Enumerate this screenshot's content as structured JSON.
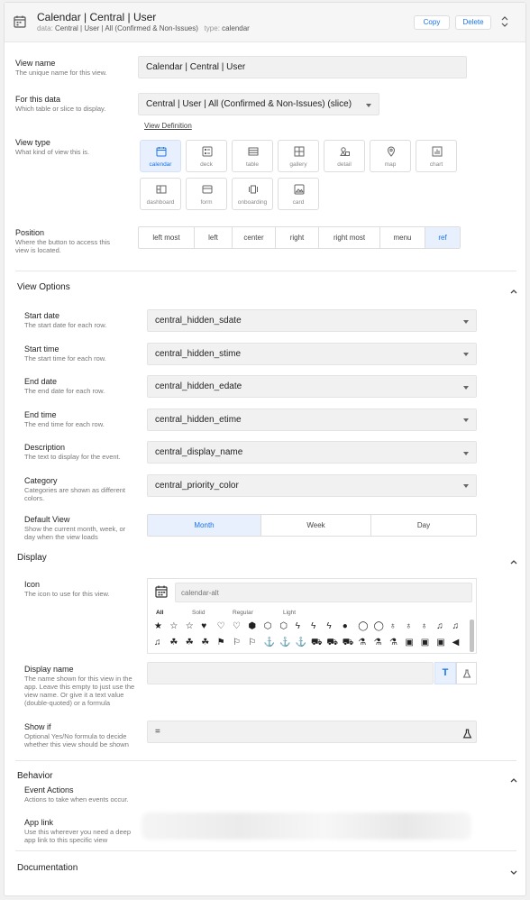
{
  "header": {
    "title": "Calendar | Central | User",
    "data_label": "data:",
    "data_value": "Central | User | All (Confirmed & Non-Issues)",
    "type_label": "type:",
    "type_value": "calendar",
    "copy_label": "Copy",
    "delete_label": "Delete"
  },
  "view_name": {
    "label": "View name",
    "desc": "The unique name for this view.",
    "value": "Calendar | Central | User"
  },
  "for_data": {
    "label": "For this data",
    "desc": "Which table or slice to display.",
    "value": "Central | User | All (Confirmed & Non-Issues) (slice)",
    "link": "View Definition"
  },
  "view_type": {
    "label": "View type",
    "desc": "What kind of view this is.",
    "options": [
      "calendar",
      "deck",
      "table",
      "gallery",
      "detail",
      "map",
      "chart",
      "dashboard",
      "form",
      "onboarding",
      "card"
    ],
    "selected": "calendar"
  },
  "position": {
    "label": "Position",
    "desc": "Where the button to access this view is located.",
    "options": [
      "left most",
      "left",
      "center",
      "right",
      "right most",
      "menu",
      "ref"
    ],
    "selected": "ref"
  },
  "view_options": {
    "title": "View Options",
    "fields": [
      {
        "label": "Start date",
        "desc": "The start date for each row.",
        "value": "central_hidden_sdate"
      },
      {
        "label": "Start time",
        "desc": "The start time for each row.",
        "value": "central_hidden_stime"
      },
      {
        "label": "End date",
        "desc": "The end date for each row.",
        "value": "central_hidden_edate"
      },
      {
        "label": "End time",
        "desc": "The end time for each row.",
        "value": "central_hidden_etime"
      },
      {
        "label": "Description",
        "desc": "The text to display for the event.",
        "value": "central_display_name"
      },
      {
        "label": "Category",
        "desc": "Categories are shown as different colors.",
        "value": "central_priority_color"
      }
    ],
    "default_view": {
      "label": "Default View",
      "desc": "Show the current month, week, or day when the view loads",
      "options": [
        "Month",
        "Week",
        "Day"
      ],
      "selected": "Month"
    }
  },
  "display": {
    "title": "Display",
    "icon": {
      "label": "Icon",
      "desc": "The icon to use for this view.",
      "placeholder": "calendar-alt",
      "tabs": [
        "All",
        "Solid",
        "Regular",
        "Light"
      ],
      "row1": [
        "★",
        "☆",
        "☆",
        "♥",
        "♡",
        "♡",
        "⬢",
        "⬡",
        "⬡",
        "ϟ",
        "ϟ",
        "ϟ",
        "●",
        "◯",
        "◯",
        "♁",
        "♁",
        "♁",
        "♫",
        "♫"
      ],
      "row2": [
        "♫",
        "☘",
        "☘",
        "☘",
        "⚑",
        "⚐",
        "⚐",
        "⚓",
        "⚓",
        "⚓",
        "⛟",
        "⛟",
        "⛟",
        "⚗",
        "⚗",
        "⚗",
        "▣",
        "▣",
        "▣",
        "◀"
      ]
    },
    "display_name": {
      "label": "Display name",
      "desc": "The name shown for this view in the app. Leave this empty to just use the view name. Or give it a text value (double-quoted) or a formula",
      "value": "",
      "text_icon": "T"
    },
    "show_if": {
      "label": "Show if",
      "desc": "Optional Yes/No formula to decide whether this view should be shown",
      "value": "="
    }
  },
  "behavior": {
    "title": "Behavior",
    "event_actions": {
      "label": "Event Actions",
      "desc": "Actions to take when events occur."
    },
    "app_link": {
      "label": "App link",
      "desc": "Use this wherever you need a deep app link to this specific view"
    }
  },
  "documentation": {
    "title": "Documentation"
  },
  "colors": {
    "accent": "#1a73e8",
    "selected_bg": "#e8f0fe",
    "field_bg": "#f1f1f1"
  }
}
